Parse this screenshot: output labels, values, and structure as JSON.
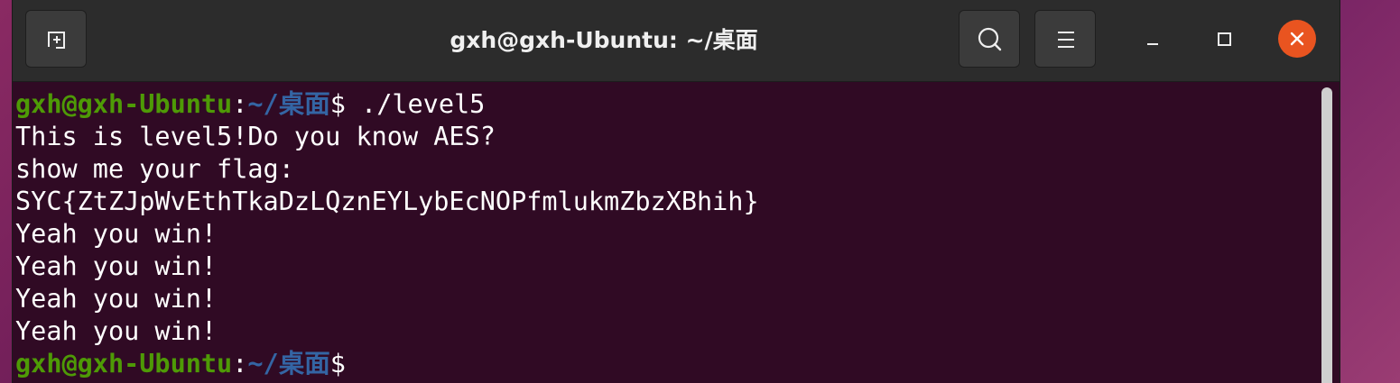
{
  "window": {
    "title": "gxh@gxh-Ubuntu: ~/桌面"
  },
  "icons": {
    "new_tab": "new-tab-icon",
    "search": "search-icon",
    "menu": "hamburger-menu-icon",
    "minimize": "minimize-icon",
    "maximize": "maximize-icon",
    "close": "close-icon"
  },
  "colors": {
    "terminal_background": "#300a24",
    "prompt_user": "#4e9a06",
    "prompt_path": "#3465a4",
    "close_button": "#e95420"
  },
  "terminal": {
    "prompt_user": "gxh@gxh-Ubuntu",
    "prompt_colon": ":",
    "prompt_path": "~/桌面",
    "prompt_symbol": "$",
    "command": " ./level5",
    "output": [
      "This is level5!Do you know AES?",
      "show me your flag:",
      "SYC{ZtZJpWvEthTkaDzLQznEYLybEcNOPfmlukmZbzXBhih}",
      "Yeah you win!",
      "Yeah you win!",
      "Yeah you win!",
      "Yeah you win!"
    ]
  }
}
